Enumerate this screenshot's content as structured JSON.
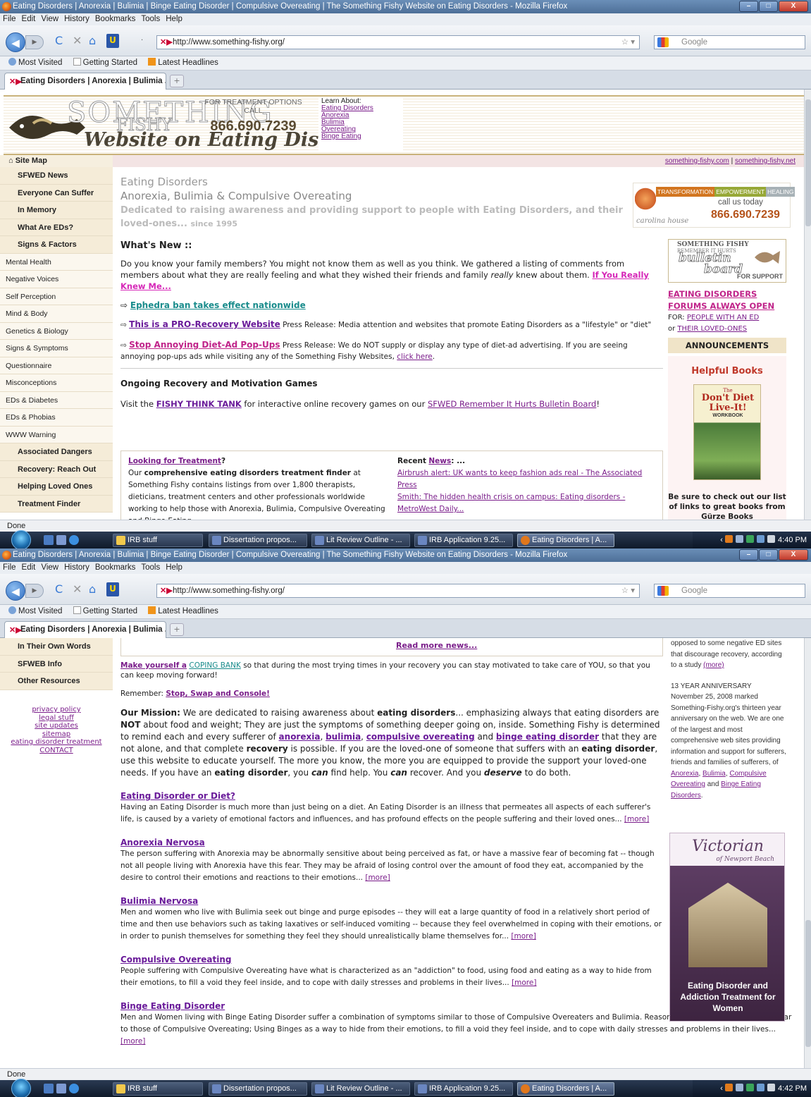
{
  "browser": {
    "title": "Eating Disorders | Anorexia | Bulimia | Binge Eating Disorder | Compulsive Overeating | The Something Fishy Website on Eating Disorders - Mozilla Firefox",
    "menu": [
      "File",
      "Edit",
      "View",
      "History",
      "Bookmarks",
      "Tools",
      "Help"
    ],
    "url": "http://www.something-fishy.org/",
    "search_placeholder": "Google",
    "bookmarks": [
      "Most Visited",
      "Getting Started",
      "Latest Headlines"
    ],
    "tab_label": "Eating Disorders | Anorexia | Bulimia ...",
    "status": "Done"
  },
  "taskbar": {
    "items": [
      "IRB stuff",
      "Dissertation propos...",
      "Lit Review Outline - ...",
      "IRB Application 9.25...",
      "Eating Disorders | A..."
    ],
    "time1": "4:40 PM",
    "time2": "4:42 PM"
  },
  "header": {
    "logo_something": "SOMETHING",
    "logo_fishy": "FISHY",
    "logo_tagline": "Website on Eating Disorders",
    "call_label": "FOR TREATMENT OPTIONS CALL",
    "phone": "866.690.7239",
    "learn_label": "Learn About:",
    "learn_links": [
      "Eating Disorders",
      "Anorexia",
      "Bulimia",
      "Overeating",
      "Binge Eating"
    ]
  },
  "strip": {
    "link1": "something-fishy.com",
    "sep": "|",
    "link2": "something-fishy.net"
  },
  "sidebar": {
    "site_map": "Site Map",
    "items": [
      {
        "label": "SFWED News",
        "bold": true
      },
      {
        "label": "Everyone Can Suffer",
        "bold": true
      },
      {
        "label": "In Memory",
        "bold": true
      },
      {
        "label": "What Are EDs?",
        "bold": true
      },
      {
        "label": "Signs & Factors",
        "bold": true
      },
      {
        "label": "Mental Health",
        "bold": false
      },
      {
        "label": "Negative Voices",
        "bold": false
      },
      {
        "label": "Self Perception",
        "bold": false
      },
      {
        "label": "Mind & Body",
        "bold": false
      },
      {
        "label": "Genetics & Biology",
        "bold": false
      },
      {
        "label": "Signs & Symptoms",
        "bold": false
      },
      {
        "label": "Questionnaire",
        "bold": false
      },
      {
        "label": "Misconceptions",
        "bold": false
      },
      {
        "label": "EDs & Diabetes",
        "bold": false
      },
      {
        "label": "EDs & Phobias",
        "bold": false
      },
      {
        "label": "WWW Warning",
        "bold": false
      },
      {
        "label": "Associated Dangers",
        "bold": true
      },
      {
        "label": "Recovery: Reach Out",
        "bold": true
      },
      {
        "label": "Helping Loved Ones",
        "bold": true
      },
      {
        "label": "Treatment Finder",
        "bold": true
      }
    ],
    "items2": [
      "In Their Own Words",
      "SFWEB Info",
      "Other Resources"
    ],
    "footer_links": [
      "privacy policy",
      "legal stuff",
      "site updates",
      "sitemap",
      "eating disorder treatment",
      "CONTACT"
    ]
  },
  "main": {
    "h1": "Eating Disorders",
    "h2": "Anorexia, Bulimia & Compulsive Overeating",
    "h3": "Dedicated to raising awareness and providing support to people with Eating Disorders, and their loved-ones...",
    "since": "since 1995",
    "whats_new": "What's New ::",
    "intro": "Do you know your family members? You might not know them as well as you think. We gathered a listing of comments from members about what they are really feeling and what they wished their friends and family",
    "intro_em": "really",
    "intro_end": "knew about them.",
    "intro_link": "If You Really Knew Me...",
    "n1": "Ephedra ban takes effect nationwide",
    "n2": "This is a PRO-Recovery Website",
    "n2_text": "Press Release: Media attention and websites that promote Eating Disorders as a \"lifestyle\" or \"diet\"",
    "n3": "Stop Annoying Diet-Ad Pop-Ups",
    "n3_text": "Press Release: We do NOT supply or display any type of diet-ad advertising. If you are seeing annoying pop-ups ads while visiting any of the Something Fishy Websites,",
    "n3_link": "click here",
    "ongoing": "Ongoing Recovery and Motivation Games",
    "visit_pre": "Visit the",
    "visit_link": "FISHY THINK TANK",
    "visit_mid": "for interactive online recovery games on our",
    "visit_link2": "SFWED Remember It Hurts Bulletin Board",
    "looking": "Looking for Treatment",
    "looking_q": "?",
    "looking_pre": "Our",
    "looking_bold": "comprehensive eating disorders treatment finder",
    "looking_text": "at Something Fishy contains listings from over 1,800 therapists, dieticians, treatment centers and other professionals worldwide working to help those with Anorexia, Bulimia, Compulsive Overeating and Binge Eating",
    "recent": "Recent",
    "recent_news": "News",
    "recent_colon": ": ...",
    "news_items": [
      "Airbrush alert: UK wants to keep fashion ads real - The Associated Press",
      "Smith: The hidden health crisis on campus: Eating disorders - MetroWest Daily..."
    ]
  },
  "right": {
    "ad_bar": [
      "TRANSFORMATION",
      "EMPOWERMENT",
      "HEALING"
    ],
    "ad_call": "call us today",
    "ad_phone": "866.690.7239",
    "ad_name": "carolina house",
    "bb_a": "SOMETHING FISHY",
    "bb_b": "REMEMBER IT HURTS",
    "bb_c": "bulletin",
    "bb_d": "board",
    "bb_e": "FOR SUPPORT",
    "forum": "EATING DISORDERS FORUMS ALWAYS OPEN",
    "for_label": "FOR:",
    "for_link1": "PEOPLE WITH AN ED",
    "or": "or",
    "for_link2": "THEIR LOVED-ONES",
    "announcements": "ANNOUNCEMENTS",
    "helpful": "Helpful Books",
    "book_top": "The",
    "book_title": "Don't Diet Live-It!",
    "book_sub": "WORKBOOK",
    "books_text": "Be sure to check out our list of links to great books from Gürze Books"
  },
  "shot2": {
    "read_more_news": "Read more news...",
    "coping_pre": "Make yourself a",
    "coping_link": "COPING BANK",
    "coping_text": "so that during the most trying times in your recovery you can stay motivated to take care of YOU, so that you can keep moving forward!",
    "remember_pre": "Remember:",
    "remember_link": "Stop, Swap and Console!",
    "mission_label": "Our Mission:",
    "mission_1": "We are dedicated to raising awareness about",
    "mission_ed": "eating disorders",
    "mission_2": "... emphasizing always that eating disorders are",
    "mission_not": "NOT",
    "mission_3": "about food and weight; They are just the symptoms of something deeper going on, inside. Something Fishy is determined to remind each and every sufferer of",
    "l_anorexia": "anorexia",
    "l_bulimia": "bulimia",
    "l_co": "compulsive overeating",
    "mission_and": "and",
    "l_bed": "binge eating disorder",
    "mission_4": "that they are not alone, and that complete",
    "mission_recovery": "recovery",
    "mission_5": "is possible. If you are the loved-one of someone that suffers with an",
    "mission_ed2": "eating disorder",
    "mission_6": ", use this website to educate yourself. The more you know, the more you are equipped to provide the support your loved-one needs. If you have an",
    "mission_ed3": "eating disorder",
    "mission_7": ", you",
    "mission_can": "can",
    "mission_8": "find help. You",
    "mission_can2": "can",
    "mission_9": "recover. And you",
    "mission_deserve": "deserve",
    "mission_10": "to do both.",
    "sections": [
      {
        "title": "Eating Disorder or Diet?",
        "text": "Having an Eating Disorder is much more than just being on a diet. An Eating Disorder is an illness that permeates all aspects of each sufferer's life, is caused by a variety of emotional factors and influences, and has profound effects on the people suffering and their loved ones..."
      },
      {
        "title": "Anorexia Nervosa",
        "text": "The person suffering with Anorexia may be abnormally sensitive about being perceived as fat, or have a massive fear of becoming fat -- though not all people living with Anorexia have this fear. They may be afraid of losing control over the amount of food they eat, accompanied by the desire to control their emotions and reactions to their emotions..."
      },
      {
        "title": "Bulimia Nervosa",
        "text": "Men and women who live with Bulimia seek out binge and purge episodes -- they will eat a large quantity of food in a relatively short period of time and then use behaviors such as taking laxatives or self-induced vomiting -- because they feel overwhelmed in coping with their emotions, or in order to punish themselves for something they feel they should unrealistically blame themselves for..."
      },
      {
        "title": "Compulsive Overeating",
        "text": "People suffering with Compulsive Overeating have what is characterized as an \"addiction\" to food, using food and eating as a way to hide from their emotions, to fill a void they feel inside, and to cope with daily stresses and problems in their lives..."
      },
      {
        "title": "Binge Eating Disorder",
        "text": "Men and Women living with Binge Eating Disorder suffer a combination of symptoms similar to those of Compulsive Overeaters and Bulimia. Reasons for Binge Eating can be similar to those of Compulsive Overeating; Using Binges as a way to hide from their emotions, to fill a void they feel inside, and to cope with daily stresses and problems in their lives..."
      }
    ],
    "more": "[more]",
    "right_1": "opposed to some negative ED sites that discourage recovery, according to a study",
    "right_more": "(more)",
    "anniv_title": "13 YEAR ANNIVERSARY",
    "anniv_text": "November 25, 2008 marked Something-Fishy.org's thirteen year anniversary on the web. We are one of the largest and most comprehensive web sites providing information and support for sufferers, friends and families of sufferers, of",
    "anniv_l1": "Anorexia",
    "anniv_l2": "Bulimia",
    "anniv_l3": "Compulsive Overeating",
    "anniv_and": "and",
    "anniv_l4": "Binge Eating Disorders",
    "vic_title": "Victorian",
    "vic_sub": "of Newport Beach",
    "vic_bottom": "Eating Disorder and Addiction Treatment for Women"
  }
}
